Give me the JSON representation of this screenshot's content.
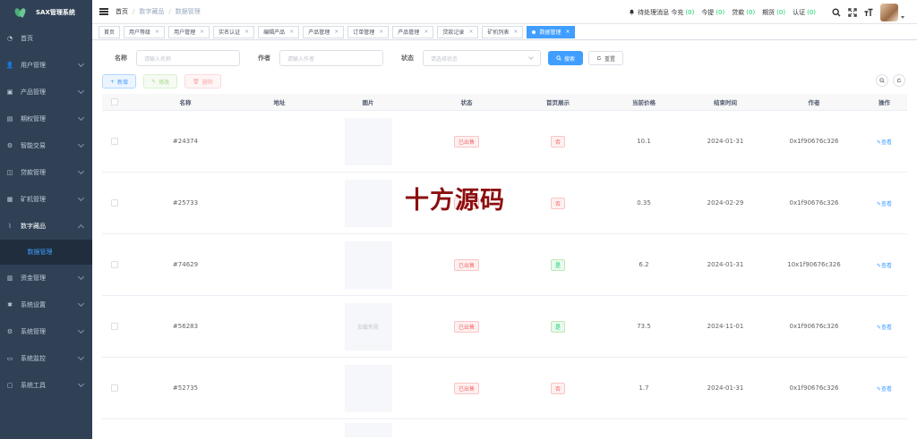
{
  "app": {
    "title": "SAX管理系统"
  },
  "sidebar": {
    "items": [
      {
        "label": "首页",
        "icon": "dashboard-icon",
        "arrow": false
      },
      {
        "label": "用户管理",
        "icon": "user-icon",
        "arrow": true
      },
      {
        "label": "产品管理",
        "icon": "product-icon",
        "arrow": true
      },
      {
        "label": "期权管理",
        "icon": "option-icon",
        "arrow": true
      },
      {
        "label": "智能交易",
        "icon": "gear-icon",
        "arrow": true
      },
      {
        "label": "贷款管理",
        "icon": "loan-icon",
        "arrow": true
      },
      {
        "label": "矿机管理",
        "icon": "miner-icon",
        "arrow": true
      },
      {
        "label": "数字藏品",
        "icon": "chart-icon",
        "arrow": true,
        "open": true
      },
      {
        "label": "资金管理",
        "icon": "fund-icon",
        "arrow": true
      },
      {
        "label": "系统设置",
        "icon": "settings-icon",
        "arrow": true
      },
      {
        "label": "系统管理",
        "icon": "gear-icon",
        "arrow": true
      },
      {
        "label": "系统监控",
        "icon": "monitor-icon",
        "arrow": true
      },
      {
        "label": "系统工具",
        "icon": "tool-icon",
        "arrow": true
      }
    ],
    "submenu": {
      "label": "数据管理"
    }
  },
  "navbar": {
    "breadcrumb": [
      "首页",
      "数字藏品",
      "数据管理"
    ],
    "notice": {
      "pending_label": "待处理消息 今充",
      "pending_count": "(0)",
      "withdraw_label": "今提",
      "withdraw_count": "(0)",
      "loan_label": "贷款",
      "loan_count": "(0)",
      "expire_label": "期货",
      "expire_count": "(0)",
      "auth_label": "认证",
      "auth_count": "(0)"
    }
  },
  "tags": [
    {
      "label": "首页",
      "closable": false
    },
    {
      "label": "用户等级",
      "closable": true
    },
    {
      "label": "用户管理",
      "closable": true
    },
    {
      "label": "实名认证",
      "closable": true
    },
    {
      "label": "编辑产品",
      "closable": true
    },
    {
      "label": "产品管理",
      "closable": true
    },
    {
      "label": "订单管理",
      "closable": true
    },
    {
      "label": "产品管理",
      "closable": true
    },
    {
      "label": "贷款记录",
      "closable": true
    },
    {
      "label": "矿机列表",
      "closable": true
    },
    {
      "label": "数据管理",
      "closable": true,
      "active": true
    }
  ],
  "search": {
    "name_label": "名称",
    "name_placeholder": "请输入名称",
    "author_label": "作者",
    "author_placeholder": "请输入作者",
    "status_label": "状态",
    "status_placeholder": "请选择状态",
    "search_button": "搜索",
    "reset_button": "重置"
  },
  "toolbar": {
    "add_button": "新增",
    "edit_button": "修改",
    "delete_button": "删除"
  },
  "table": {
    "columns": [
      "名称",
      "地址",
      "图片",
      "状态",
      "首页展示",
      "当前价格",
      "结束时间",
      "作者",
      "操作"
    ],
    "rows": [
      {
        "name": "#24374",
        "address": "",
        "image_text": "",
        "status": "已出售",
        "home": "否",
        "home_type": "red",
        "price": "10.1",
        "end": "2024-01-31",
        "author": "0x1f90676c326",
        "op": "查看"
      },
      {
        "name": "#25733",
        "address": "",
        "image_text": "",
        "status": "已出售",
        "home": "否",
        "home_type": "red",
        "price": "0.35",
        "end": "2024-02-29",
        "author": "0x1f90676c326",
        "op": "查看"
      },
      {
        "name": "#74629",
        "address": "",
        "image_text": "",
        "status": "已出售",
        "home": "是",
        "home_type": "green",
        "price": "6.2",
        "end": "2024-01-31",
        "author": "10x1f90676c326",
        "op": "查看"
      },
      {
        "name": "#56283",
        "address": "",
        "image_text": "加载失败",
        "status": "已出售",
        "home": "是",
        "home_type": "green",
        "price": "73.5",
        "end": "2024-11-01",
        "author": "0x1f90676c326",
        "op": "查看"
      },
      {
        "name": "#52735",
        "address": "",
        "image_text": "",
        "status": "已出售",
        "home": "否",
        "home_type": "red",
        "price": "1.7",
        "end": "2024-01-31",
        "author": "0x1f90676c326",
        "op": "查看"
      }
    ]
  },
  "watermark": {
    "text": "十方源码"
  }
}
